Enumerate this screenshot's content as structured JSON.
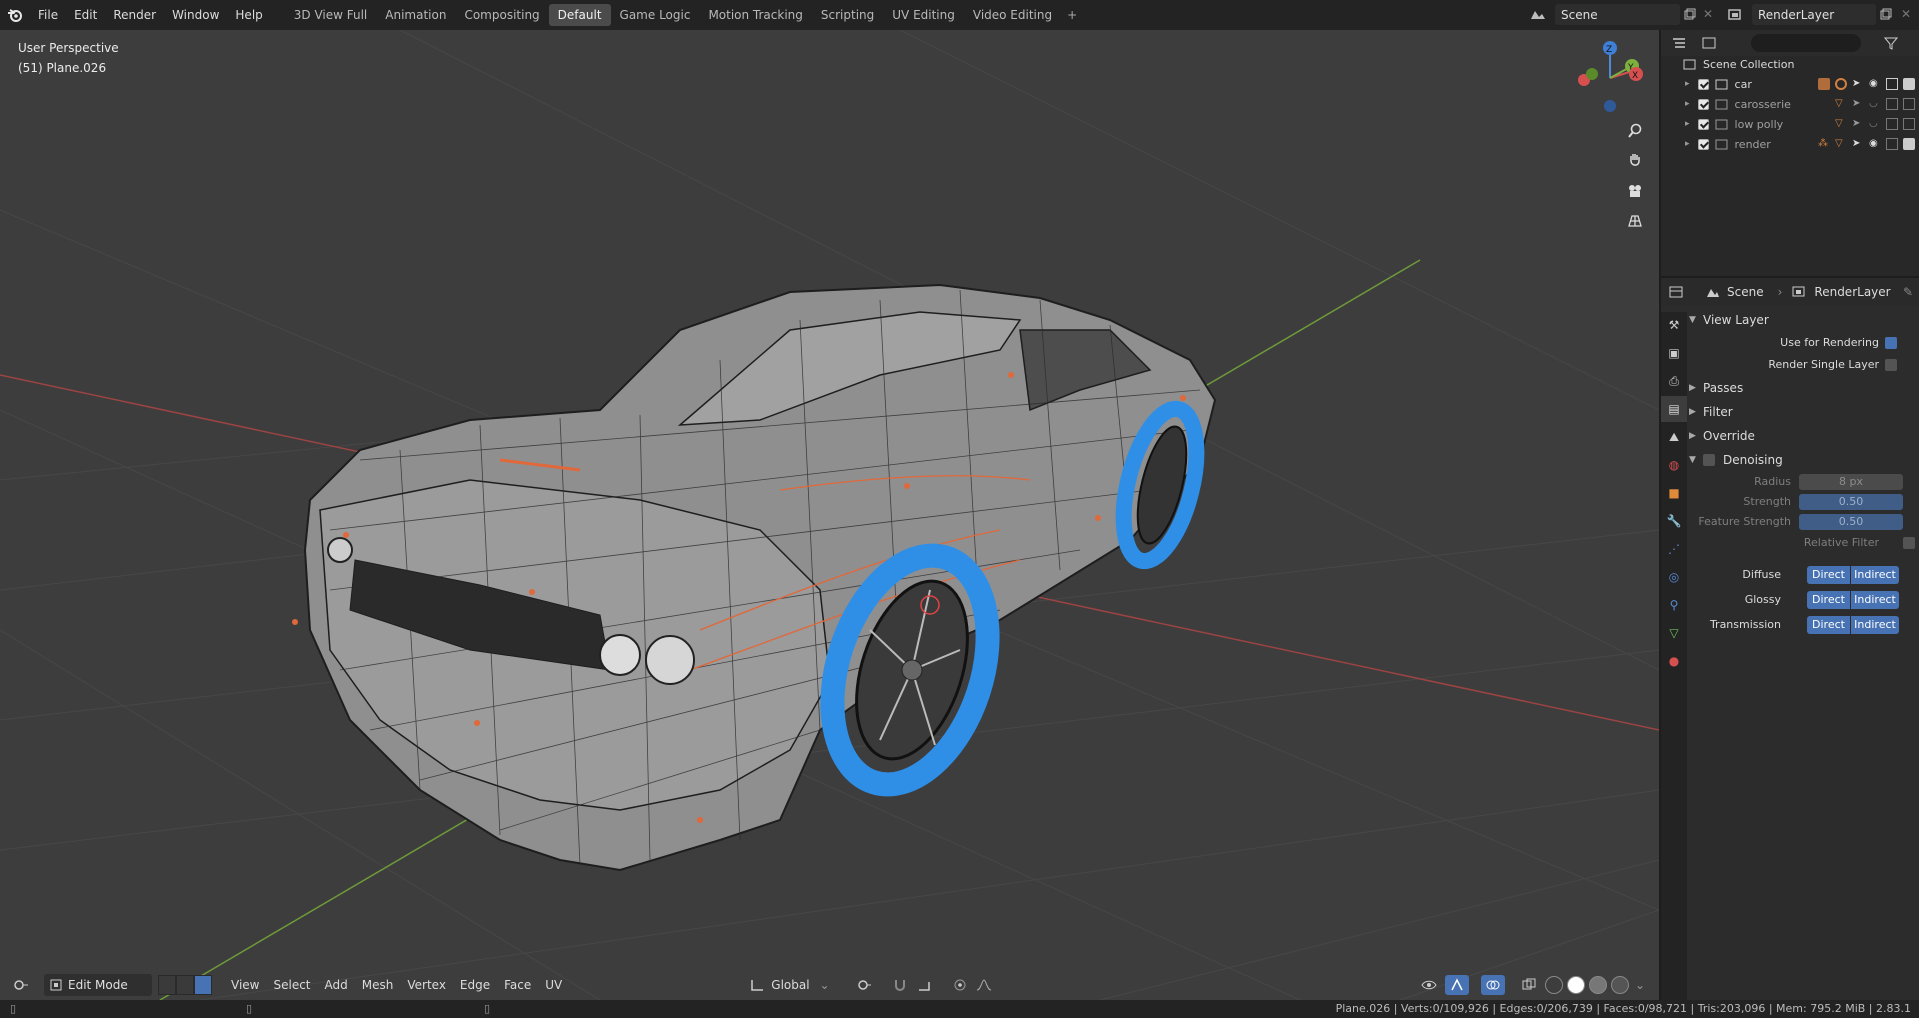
{
  "menus": [
    "File",
    "Edit",
    "Render",
    "Window",
    "Help"
  ],
  "workspaces": [
    "3D View Full",
    "Animation",
    "Compositing",
    "Default",
    "Game Logic",
    "Motion Tracking",
    "Scripting",
    "UV Editing",
    "Video Editing"
  ],
  "active_workspace": "Default",
  "scene_name": "Scene",
  "view_layer_name": "RenderLayer",
  "viewport": {
    "perspective": "User Perspective",
    "object": "(51) Plane.026",
    "gizmo_axes": [
      "Z",
      "Y",
      "X"
    ]
  },
  "viewport_header": {
    "mode": "Edit Mode",
    "menus": [
      "View",
      "Select",
      "Add",
      "Mesh",
      "Vertex",
      "Edge",
      "Face",
      "UV"
    ],
    "orientation": "Global"
  },
  "outliner": {
    "root": "Scene Collection",
    "collections": [
      {
        "name": "car",
        "dim": false
      },
      {
        "name": "carosserie",
        "dim": true
      },
      {
        "name": "low polly",
        "dim": true
      },
      {
        "name": "render",
        "dim": true
      }
    ]
  },
  "properties": {
    "breadcrumb": [
      "Scene",
      "RenderLayer"
    ],
    "view_layer_panel": "View Layer",
    "use_for_rendering": "Use for Rendering",
    "use_for_rendering_on": true,
    "render_single_layer": "Render Single Layer",
    "render_single_layer_on": false,
    "subpanels": [
      "Passes",
      "Filter",
      "Override"
    ],
    "denoising": "Denoising",
    "radius_label": "Radius",
    "radius_value": "8 px",
    "strength_label": "Strength",
    "strength_value": "0.50",
    "feature_strength_label": "Feature Strength",
    "feature_strength_value": "0.50",
    "relative_filter": "Relative Filter",
    "rows": [
      {
        "label": "Diffuse",
        "a": "Direct",
        "b": "Indirect"
      },
      {
        "label": "Glossy",
        "a": "Direct",
        "b": "Indirect"
      },
      {
        "label": "Transmission",
        "a": "Direct",
        "b": "Indirect"
      }
    ]
  },
  "status": "Plane.026 | Verts:0/109,926 | Edges:0/206,739 | Faces:0/98,721 | Tris:203,096 | Mem: 795.2 MiB | 2.83.1",
  "colors": {
    "accent": "#4772b3",
    "selected_mesh": "#2f8fe6",
    "edge_orange": "#e0683a"
  }
}
